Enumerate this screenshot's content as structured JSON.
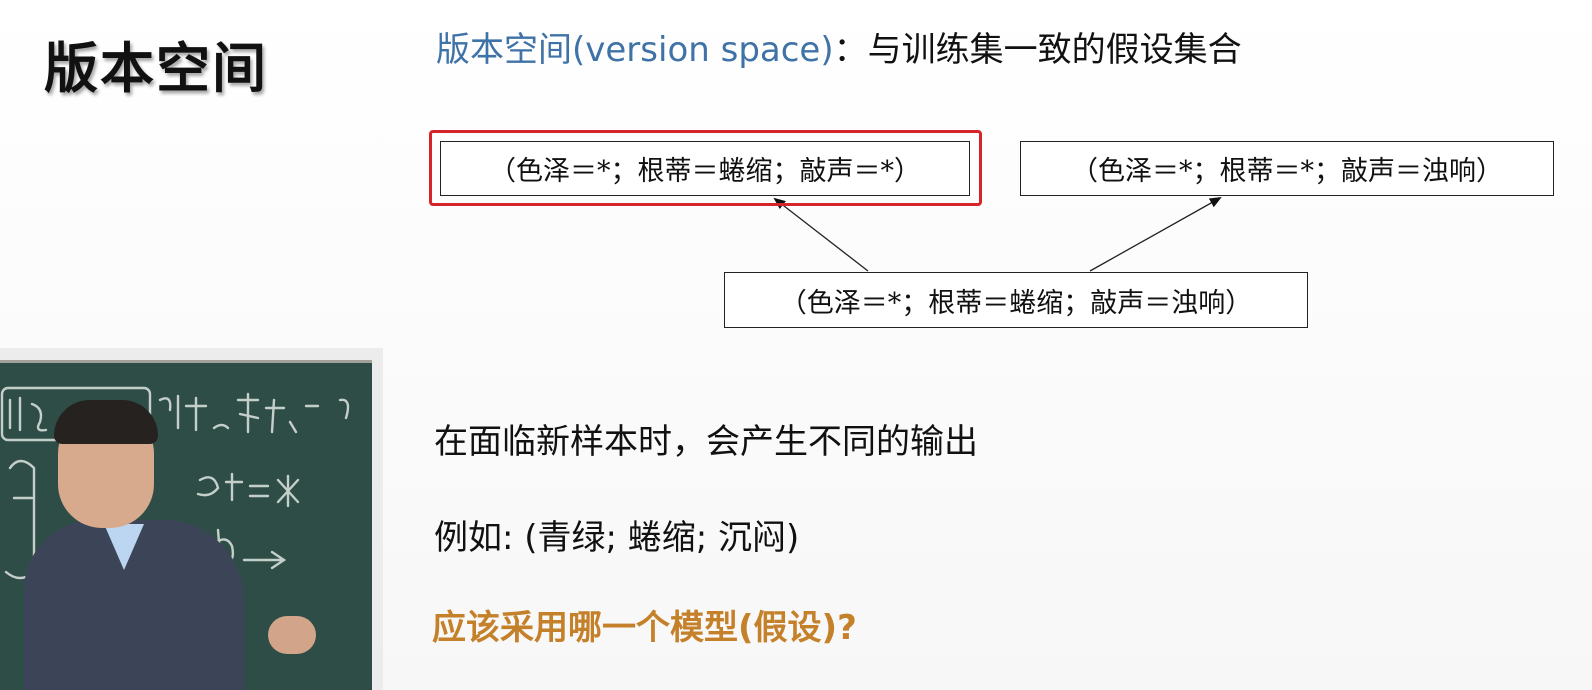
{
  "slide": {
    "title": "版本空间",
    "heading_term": "版本空间(version space)",
    "heading_desc": "：与训练集一致的假设集合"
  },
  "hypotheses": {
    "specific_left": "（色泽＝*；根蒂＝蜷缩；敲声＝*）",
    "specific_right": "（色泽＝*；根蒂＝*；敲声＝浊响）",
    "most_specific": "（色泽＝*；根蒂＝蜷缩；敲声＝浊响）",
    "highlight_color": "#d6252a"
  },
  "body": {
    "line1": "在面临新样本时，会产生不同的输出",
    "line2": "例如: (青绿; 蜷缩; 沉闷)",
    "line3": "应该采用哪一个模型(假设)?"
  },
  "colors": {
    "term_blue": "#3f72a6",
    "question_orange": "#c5802a"
  }
}
